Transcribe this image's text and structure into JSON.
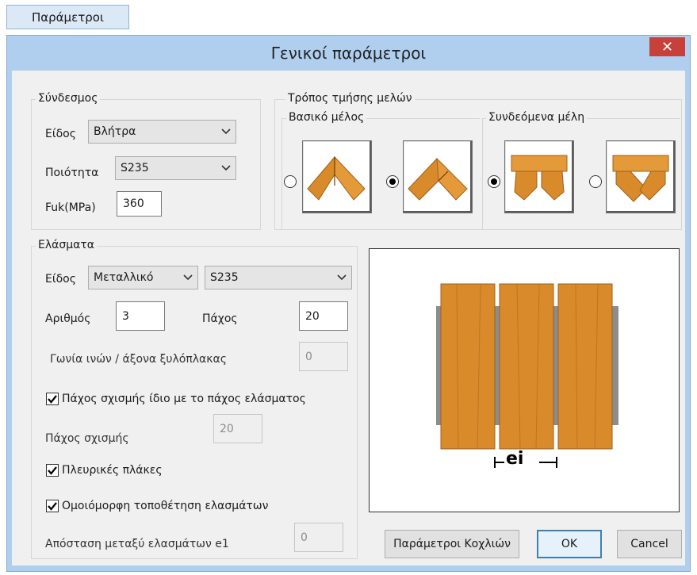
{
  "top_button": {
    "label": "Παράμετροι"
  },
  "dialog": {
    "title": "Γενικοί παράμετροι",
    "close_glyph": "✕"
  },
  "syndesmos": {
    "group_label": "Σύνδεσμος",
    "type_label": "Είδος",
    "type_value": "Βλήτρα",
    "quality_label": "Ποιότητα",
    "quality_value": "S235",
    "fuk_label": "Fuk(MPa)",
    "fuk_value": "360"
  },
  "cut_mode": {
    "group_label": "Τρόπος τμήσης μελών",
    "main_label": "Βασικό μέλος",
    "connected_label": "Συνδεόμενα μέλη",
    "main_selected": 2,
    "connected_selected": 1
  },
  "plates": {
    "group_label": "Ελάσματα",
    "type_label": "Είδος",
    "material_value": "Μεταλλικό",
    "grade_value": "S235",
    "count_label": "Αριθμός",
    "count_value": "3",
    "thickness_label": "Πάχος",
    "thickness_value": "20",
    "angle_label": "Γωνία ινών / άξονα ξυλόπλακας",
    "angle_value": "0",
    "same_slot_label": "Πάχος σχισμής ίδιο με το πάχος ελάσματος",
    "same_slot_checked": true,
    "slot_label": "Πάχος σχισμής",
    "slot_value": "20",
    "side_plates_label": "Πλευρικές πλάκες",
    "side_plates_checked": true,
    "uniform_label": "Ομοιόμορφη τοποθέτηση ελασμάτων",
    "uniform_checked": true,
    "spacing_label": "Απόσταση μεταξύ ελασμάτων e1",
    "spacing_value": "0"
  },
  "preview": {
    "dimension_label": "ei"
  },
  "buttons": {
    "bolts": "Παράμετροι Κοχλιών",
    "ok": "OK",
    "cancel": "Cancel"
  },
  "colors": {
    "titlebar": "#b0cfee",
    "close": "#c7403a",
    "wood": "#d98a2b",
    "metal": "#8c8c8c"
  }
}
